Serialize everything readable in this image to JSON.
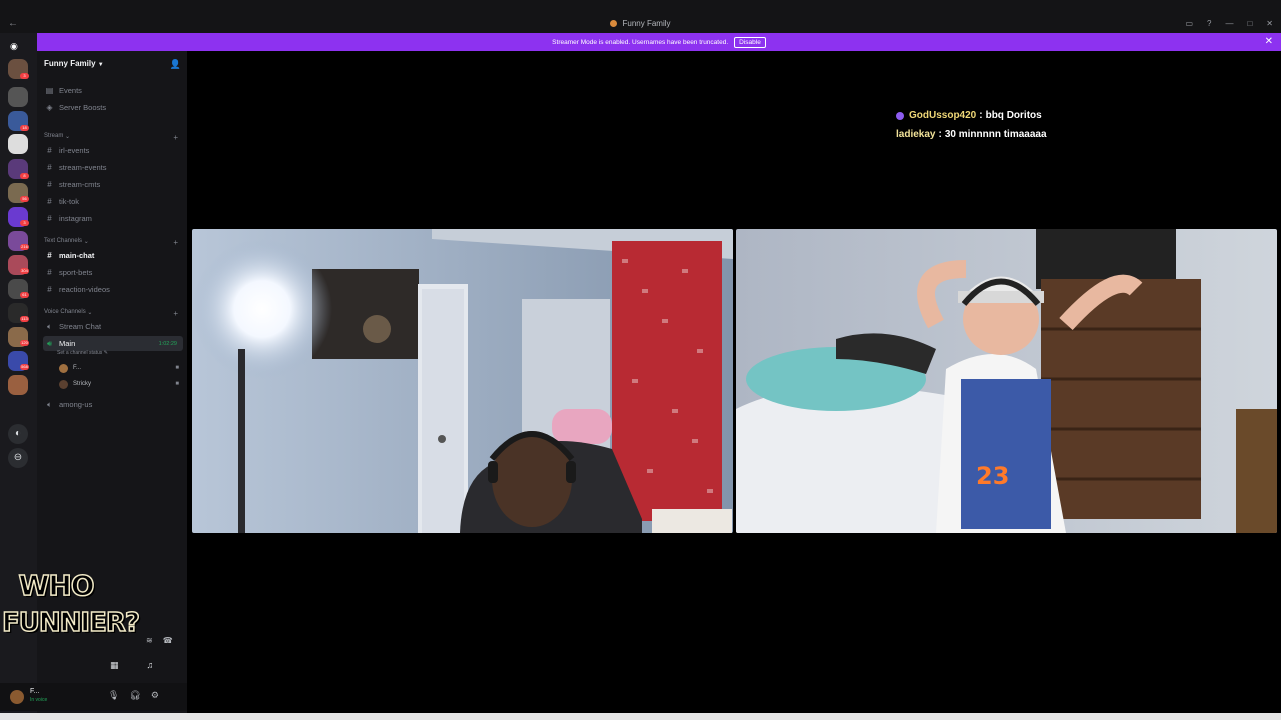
{
  "window": {
    "title": "Funny Family"
  },
  "banner": {
    "message": "Streamer Mode is enabled. Usernames have been truncated.",
    "disable_label": "Disable"
  },
  "server_rail": {
    "badges": [
      "3",
      "18",
      "8",
      "56",
      "3",
      "216",
      "304",
      "61",
      "113",
      "120",
      "568"
    ]
  },
  "sidebar": {
    "server_name": "Funny Family",
    "top_items": [
      {
        "label": "Events",
        "icon": "calendar-icon"
      },
      {
        "label": "Server Boosts",
        "icon": "boost-icon"
      }
    ],
    "stream_category": "Stream",
    "stream_channels": [
      "irl-events",
      "stream-events",
      "stream-cmts",
      "tik-tok",
      "instagram"
    ],
    "text_category": "Text Channels",
    "text_channels": [
      "main-chat",
      "sport-bets",
      "reaction-videos"
    ],
    "voice_category": "Voice Channels",
    "voice_channels": {
      "stream_chat": "Stream Chat",
      "main": "Main",
      "main_timer": "1:02:29",
      "main_status": "Set a channel status",
      "members": [
        "F...",
        "Stricky"
      ],
      "among_us": "among-us"
    }
  },
  "overlay": {
    "line1": "WHO",
    "line2": "FUNNIER?"
  },
  "userbar": {
    "name": "F...",
    "status": "In voice"
  },
  "chat": [
    {
      "user": "GodUssop420",
      "sep": ":",
      "text": "bbq Doritos"
    },
    {
      "user": "ladiekay",
      "sep": ":",
      "text": "30 minnnnn timaaaaa"
    }
  ],
  "colors": {
    "accent": "#8d32f0",
    "sidebar_bg": "#151518",
    "online": "#23a55a",
    "notification": "#f23f43"
  }
}
